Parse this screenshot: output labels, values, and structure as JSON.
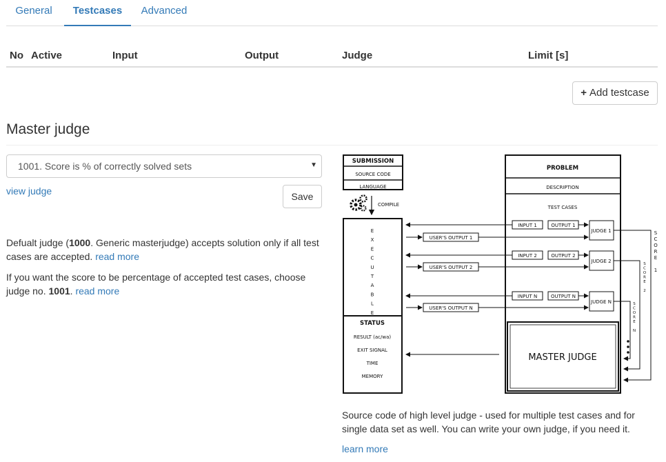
{
  "tabs": [
    {
      "label": "General"
    },
    {
      "label": "Testcases"
    },
    {
      "label": "Advanced"
    }
  ],
  "table": {
    "headers": [
      "No",
      "Active",
      "Input",
      "Output",
      "Judge",
      "Limit [s]"
    ]
  },
  "add_testcase_label": "Add testcase",
  "master_judge": {
    "title": "Master judge",
    "selected": "1001. Score is % of correctly solved sets",
    "view_judge": "view judge",
    "save_label": "Save",
    "p1": {
      "before": "Defualt judge (",
      "bold": "1000",
      "after": ". Generic masterjudge) accepts solution only if all test cases are accepted. ",
      "link": "read more"
    },
    "p2": {
      "before": "If you want the score to be percentage of accepted test cases, choose judge no. ",
      "bold": "1001",
      "after": ". ",
      "link": "read more"
    },
    "caption": "Source code of high level judge - used for multiple test cases and for single data set as well. You can write your own judge, if you need it.",
    "learn_more": "learn more"
  },
  "diagram": {
    "submission": "SUBMISSION",
    "source_code": "SOURCE CODE",
    "language": "LANGUAGE",
    "compile": "COMPILE",
    "executable": [
      "E",
      "X",
      "E",
      "C",
      "U",
      "T",
      "A",
      "B",
      "L",
      "E"
    ],
    "status": "STATUS",
    "result": "RESULT (ac/wa)",
    "exit_signal": "EXIT SIGNAL",
    "time": "TIME",
    "memory": "MEMORY",
    "problem": "PROBLEM",
    "description": "DESCRIPTION",
    "test_cases": "TEST CASES",
    "input1": "INPUT 1",
    "output1": "OUTPUT 1",
    "judge1": "JUDGE 1",
    "user_output1": "USER'S OUTPUT 1",
    "input2": "INPUT 2",
    "output2": "OUTPUT 2",
    "judge2": "JUDGE 2",
    "user_output2": "USER'S OUTPUT 2",
    "inputn": "INPUT N",
    "outputn": "OUTPUT N",
    "judgen": "JUDGE N",
    "user_outputn": "USER'S OUTPUT N",
    "master_judge": "MASTER JUDGE",
    "score1": [
      "S",
      "C",
      "O",
      "R",
      "E",
      "",
      "1"
    ],
    "score2": [
      "S",
      "C",
      "O",
      "R",
      "E",
      "",
      "2"
    ],
    "scoren": [
      "S",
      "C",
      "O",
      "R",
      "E",
      "",
      "N"
    ]
  }
}
